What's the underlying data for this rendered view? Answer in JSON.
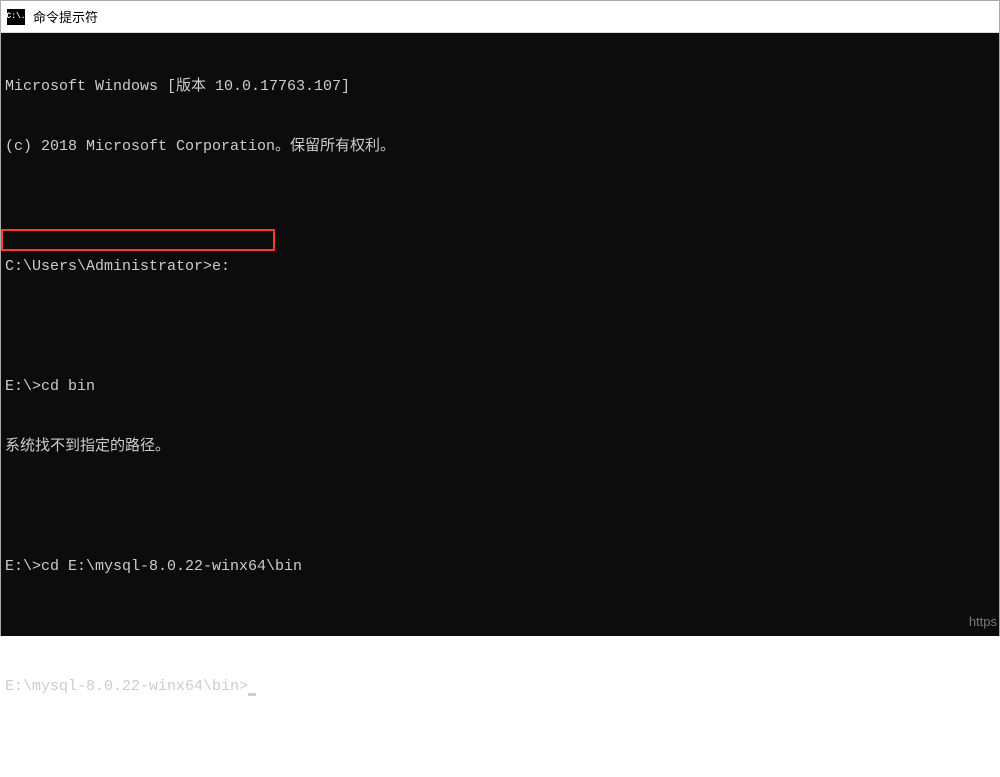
{
  "window": {
    "title": "命令提示符",
    "icon_label": "C:\\."
  },
  "terminal": {
    "lines": [
      "Microsoft Windows [版本 10.0.17763.107]",
      "(c) 2018 Microsoft Corporation。保留所有权利。",
      "",
      "C:\\Users\\Administrator>e:",
      "",
      "E:\\>cd bin",
      "系统找不到指定的路径。",
      "",
      "E:\\>cd E:\\mysql-8.0.22-winx64\\bin",
      "",
      "E:\\mysql-8.0.22-winx64\\bin>"
    ]
  },
  "watermark": "https"
}
